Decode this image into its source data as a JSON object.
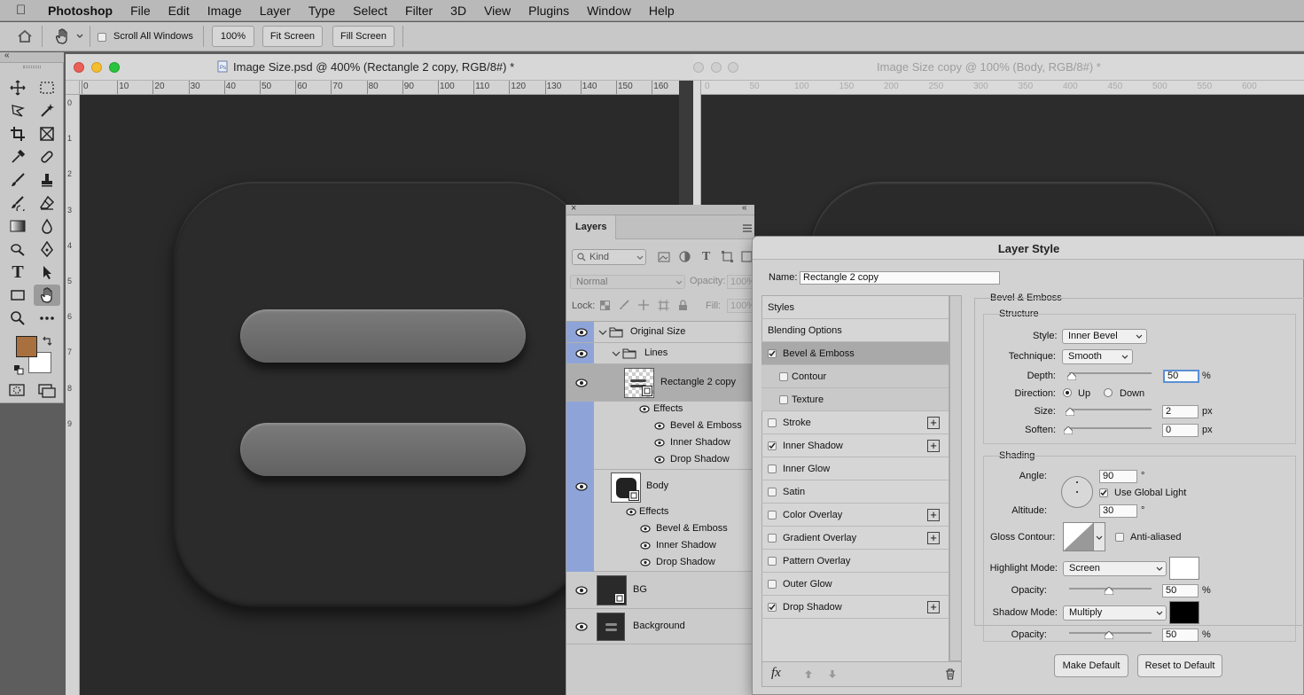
{
  "menubar": {
    "app": "Photoshop",
    "items": [
      "File",
      "Edit",
      "Image",
      "Layer",
      "Type",
      "Select",
      "Filter",
      "3D",
      "View",
      "Plugins",
      "Window",
      "Help"
    ]
  },
  "options": {
    "scroll_all": "Scroll All Windows",
    "zoom": "100%",
    "fit_screen": "Fit Screen",
    "fill_screen": "Fill Screen"
  },
  "doc1": {
    "title": "Image Size.psd @ 400% (Rectangle 2 copy, RGB/8#) *",
    "ruler_h": [
      "0",
      "10",
      "20",
      "30",
      "40",
      "50",
      "60",
      "70",
      "80",
      "90",
      "100",
      "110",
      "120",
      "130",
      "140",
      "150",
      "160"
    ],
    "ruler_v": [
      "0",
      "1",
      "2",
      "3",
      "4",
      "5",
      "6",
      "7",
      "8",
      "9"
    ]
  },
  "doc2": {
    "title": "Image Size copy @ 100% (Body, RGB/8#) *",
    "ruler_h": [
      "0",
      "50",
      "100",
      "150",
      "200",
      "250",
      "300",
      "350",
      "400",
      "450",
      "500",
      "550",
      "600"
    ]
  },
  "layers": {
    "tab": "Layers",
    "kind": "Kind",
    "blend": "Normal",
    "opacity_label": "Opacity:",
    "opacity": "100%",
    "lock_label": "Lock:",
    "fill_label": "Fill:",
    "fill": "100%",
    "rows": {
      "original_size": "Original Size",
      "lines": "Lines",
      "rect2copy": "Rectangle 2 copy",
      "effects1": "Effects",
      "bevel1": "Bevel & Emboss",
      "inner1": "Inner Shadow",
      "drop1": "Drop Shadow",
      "body": "Body",
      "effects2": "Effects",
      "bevel2": "Bevel & Emboss",
      "inner2": "Inner Shadow",
      "drop2": "Drop Shadow",
      "bg": "BG",
      "background": "Background"
    }
  },
  "dialog": {
    "title": "Layer Style",
    "name_label": "Name:",
    "name_value": "Rectangle 2 copy",
    "styles_header": "Styles",
    "blending": "Blending Options",
    "styles": [
      {
        "label": "Bevel & Emboss",
        "checked": true,
        "plus": false
      },
      {
        "label": "Contour",
        "checked": false,
        "plus": false
      },
      {
        "label": "Texture",
        "checked": false,
        "plus": false
      },
      {
        "label": "Stroke",
        "checked": false,
        "plus": true
      },
      {
        "label": "Inner Shadow",
        "checked": true,
        "plus": true
      },
      {
        "label": "Inner Glow",
        "checked": false,
        "plus": false
      },
      {
        "label": "Satin",
        "checked": false,
        "plus": false
      },
      {
        "label": "Color Overlay",
        "checked": false,
        "plus": true
      },
      {
        "label": "Gradient Overlay",
        "checked": false,
        "plus": true
      },
      {
        "label": "Pattern Overlay",
        "checked": false,
        "plus": false
      },
      {
        "label": "Outer Glow",
        "checked": false,
        "plus": false
      },
      {
        "label": "Drop Shadow",
        "checked": true,
        "plus": true
      }
    ],
    "fx": "fx",
    "bevel_group": "Bevel & Emboss",
    "structure": "Structure",
    "style_label": "Style:",
    "style_value": "Inner Bevel",
    "technique_label": "Technique:",
    "technique_value": "Smooth",
    "depth_label": "Depth:",
    "depth_value": "50",
    "pct": "%",
    "direction_label": "Direction:",
    "up": "Up",
    "down": "Down",
    "size_label": "Size:",
    "size_value": "2",
    "soften_label": "Soften:",
    "soften_value": "0",
    "px": "px",
    "shading": "Shading",
    "angle_label": "Angle:",
    "angle_value": "90",
    "deg": "°",
    "global_light": "Use Global Light",
    "altitude_label": "Altitude:",
    "altitude_value": "30",
    "gloss_label": "Gloss Contour:",
    "anti_aliased": "Anti-aliased",
    "highlight_label": "Highlight Mode:",
    "highlight_value": "Screen",
    "highlight_color": "#ffffff",
    "opacity_label": "Opacity:",
    "highlight_opacity": "50",
    "shadow_label": "Shadow Mode:",
    "shadow_value": "Multiply",
    "shadow_color": "#000000",
    "shadow_opacity": "50",
    "make_default": "Make Default",
    "reset_default": "Reset to Default"
  },
  "colors": {
    "foreground": "#a8703f",
    "background": "#ffffff",
    "layer_selection": "#8ea4d8"
  }
}
